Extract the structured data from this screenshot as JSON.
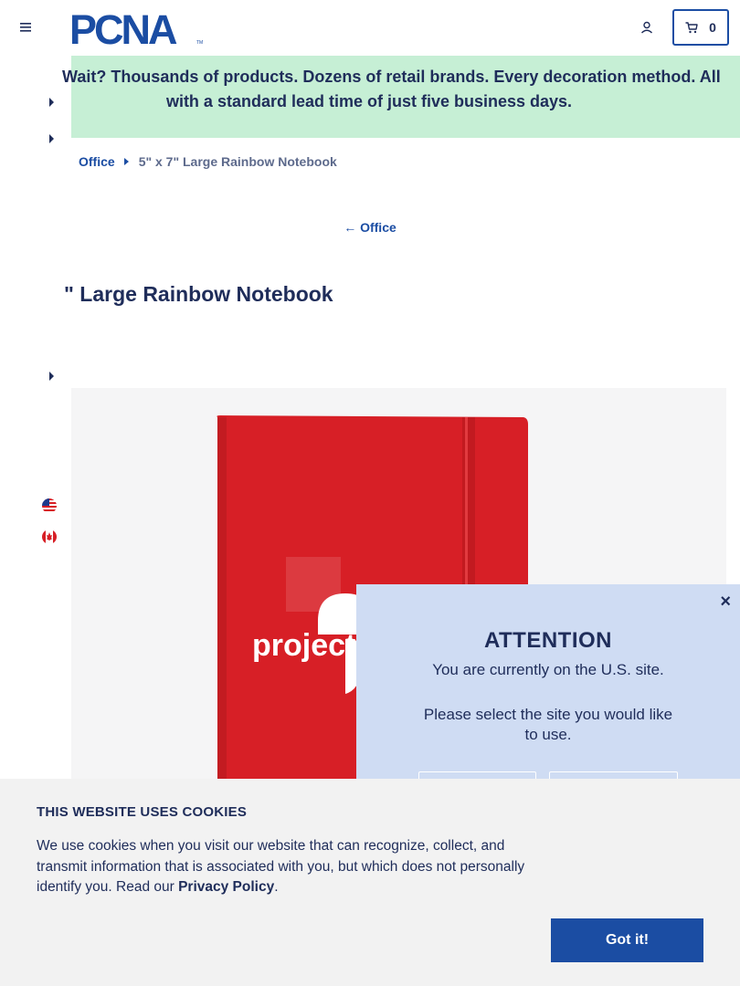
{
  "header": {
    "logo_text": "PCNA",
    "logo_tm": "TM",
    "cart_count": "0"
  },
  "promo": {
    "line1": "Wait? Thousands of products. Dozens of retail brands. Every decoration method. All",
    "line2": "with a standard lead time of just five business days."
  },
  "breadcrumb": {
    "parent": "Office",
    "current": "5\" x 7\" Large Rainbow Notebook"
  },
  "back_link": {
    "label": "Office"
  },
  "product": {
    "title": "\" Large Rainbow Notebook",
    "image_text": "project",
    "image_color": "#d71f26"
  },
  "modal": {
    "title": "ATTENTION",
    "message": "You are currently on the U.S. site.",
    "prompt": "Please select the site you would like to use.",
    "close_glyph": "×"
  },
  "cookie": {
    "title": "THIS WEBSITE USES COOKIES",
    "text": "We use cookies when you visit our website that can recognize, collect, and transmit information that is associated with you, but which does not personally identify you. Read our ",
    "link": "Privacy Policy",
    "suffix": ".",
    "button": "Got it!"
  },
  "colors": {
    "brand_blue": "#1b4da3",
    "promo_green": "#c6efd5",
    "modal_bg": "#cfdcf3",
    "navy_text": "#1f2d5a"
  }
}
